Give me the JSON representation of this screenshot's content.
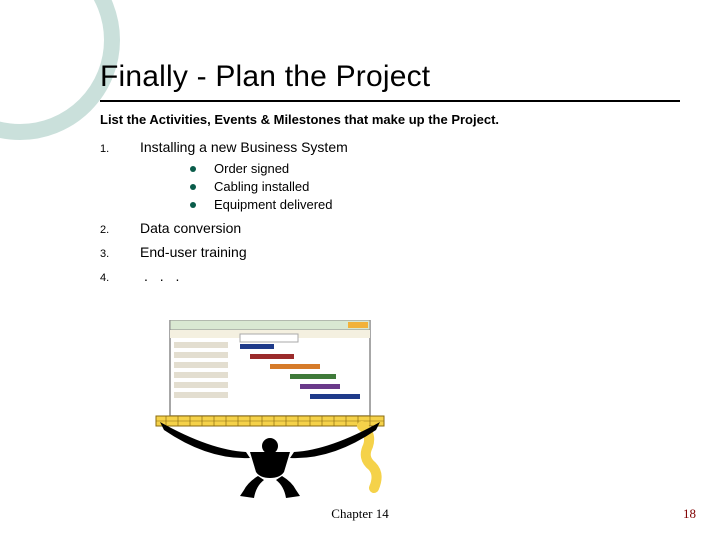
{
  "title": "Finally - Plan the Project",
  "subtitle": "List the Activities, Events & Milestones that make up the Project.",
  "items": [
    {
      "num": "1.",
      "text": "Installing a new Business System",
      "sub": [
        "Order signed",
        "Cabling installed",
        "Equipment delivered"
      ]
    },
    {
      "num": "2.",
      "text": "Data conversion"
    },
    {
      "num": "3.",
      "text": "End-user training"
    },
    {
      "num": "4.",
      "text": ". . ."
    }
  ],
  "footer": {
    "chapter": "Chapter 14",
    "page": "18"
  }
}
